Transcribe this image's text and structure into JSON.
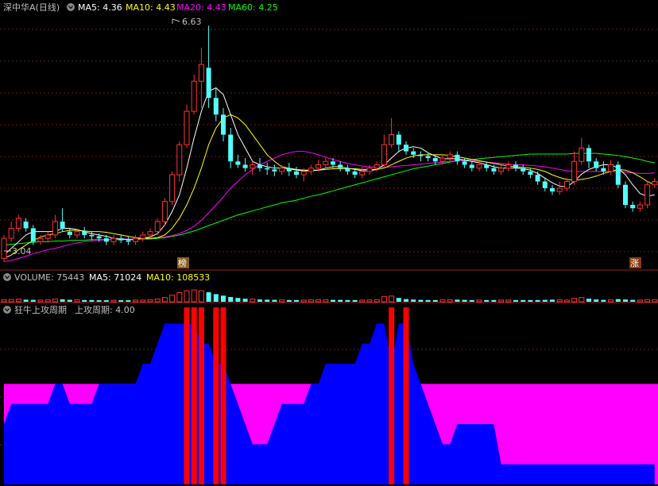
{
  "header": {
    "stock_title": "深中华A(日线)",
    "ma5_label": "MA5: 4.36",
    "ma10_label": "MA10: 4.43",
    "ma20_label": "MA20: 4.43",
    "ma60_label": "MA60: 4.25"
  },
  "annotations": {
    "high_label": "6.63",
    "low_label": "3.04",
    "marker_bang": "榜",
    "marker_zhang": "涨"
  },
  "volume_header": {
    "title": "VOLUME: 75443",
    "ma5_label": "MA5: 71024",
    "ma10_label": "MA10: 108533"
  },
  "indicator_header": {
    "title": "狂牛上攻周期",
    "value_label": "上攻周期: 4.00"
  },
  "colors": {
    "up": "#ff3232",
    "down": "#54ffff",
    "ma5": "#ffffff",
    "ma10": "#ffff00",
    "ma20": "#ff00ff",
    "ma60": "#00ff00",
    "magenta_area": "#ff00ff",
    "blue_area": "#0000ff",
    "red_bar": "#ff0000",
    "grid": "#7a1515"
  },
  "chart_data": {
    "type": "candlestick",
    "price_ylim": [
      3.0,
      6.8
    ],
    "candles": [
      {
        "o": 3.15,
        "c": 3.45,
        "h": 3.5,
        "l": 3.1
      },
      {
        "o": 3.45,
        "c": 3.6,
        "h": 3.7,
        "l": 3.4
      },
      {
        "o": 3.6,
        "c": 3.75,
        "h": 3.8,
        "l": 3.55
      },
      {
        "o": 3.7,
        "c": 3.6,
        "h": 3.75,
        "l": 3.55
      },
      {
        "o": 3.6,
        "c": 3.4,
        "h": 3.65,
        "l": 3.35
      },
      {
        "o": 3.4,
        "c": 3.45,
        "h": 3.5,
        "l": 3.35
      },
      {
        "o": 3.45,
        "c": 3.5,
        "h": 3.55,
        "l": 3.4
      },
      {
        "o": 3.5,
        "c": 3.7,
        "h": 3.8,
        "l": 3.45
      },
      {
        "o": 3.7,
        "c": 3.6,
        "h": 3.9,
        "l": 3.55
      },
      {
        "o": 3.55,
        "c": 3.5,
        "h": 3.6,
        "l": 3.45
      },
      {
        "o": 3.5,
        "c": 3.55,
        "h": 3.6,
        "l": 3.45
      },
      {
        "o": 3.55,
        "c": 3.5,
        "h": 3.62,
        "l": 3.45
      },
      {
        "o": 3.5,
        "c": 3.48,
        "h": 3.55,
        "l": 3.42
      },
      {
        "o": 3.48,
        "c": 3.45,
        "h": 3.52,
        "l": 3.4
      },
      {
        "o": 3.45,
        "c": 3.4,
        "h": 3.5,
        "l": 3.35
      },
      {
        "o": 3.4,
        "c": 3.45,
        "h": 3.5,
        "l": 3.35
      },
      {
        "o": 3.45,
        "c": 3.42,
        "h": 3.5,
        "l": 3.38
      },
      {
        "o": 3.42,
        "c": 3.4,
        "h": 3.48,
        "l": 3.35
      },
      {
        "o": 3.4,
        "c": 3.45,
        "h": 3.5,
        "l": 3.35
      },
      {
        "o": 3.45,
        "c": 3.5,
        "h": 3.55,
        "l": 3.4
      },
      {
        "o": 3.5,
        "c": 3.55,
        "h": 3.6,
        "l": 3.45
      },
      {
        "o": 3.55,
        "c": 3.7,
        "h": 3.75,
        "l": 3.5
      },
      {
        "o": 3.7,
        "c": 4.0,
        "h": 4.05,
        "l": 3.65
      },
      {
        "o": 4.0,
        "c": 4.4,
        "h": 4.45,
        "l": 3.95
      },
      {
        "o": 4.4,
        "c": 4.85,
        "h": 4.9,
        "l": 4.3
      },
      {
        "o": 4.85,
        "c": 5.35,
        "h": 5.45,
        "l": 4.8
      },
      {
        "o": 5.35,
        "c": 5.8,
        "h": 5.9,
        "l": 5.3
      },
      {
        "o": 5.8,
        "c": 6.05,
        "h": 6.3,
        "l": 5.4
      },
      {
        "o": 6.0,
        "c": 5.55,
        "h": 6.63,
        "l": 5.4
      },
      {
        "o": 5.55,
        "c": 5.3,
        "h": 5.7,
        "l": 5.2
      },
      {
        "o": 5.3,
        "c": 5.0,
        "h": 5.4,
        "l": 4.9
      },
      {
        "o": 5.0,
        "c": 4.6,
        "h": 5.1,
        "l": 4.5
      },
      {
        "o": 4.6,
        "c": 4.55,
        "h": 4.7,
        "l": 4.5
      },
      {
        "o": 4.55,
        "c": 4.5,
        "h": 4.65,
        "l": 4.45
      },
      {
        "o": 4.5,
        "c": 4.55,
        "h": 4.6,
        "l": 4.4
      },
      {
        "o": 4.55,
        "c": 4.5,
        "h": 4.65,
        "l": 4.45
      },
      {
        "o": 4.5,
        "c": 4.48,
        "h": 4.58,
        "l": 4.4
      },
      {
        "o": 4.48,
        "c": 4.45,
        "h": 4.55,
        "l": 4.38
      },
      {
        "o": 4.45,
        "c": 4.5,
        "h": 4.55,
        "l": 4.4
      },
      {
        "o": 4.5,
        "c": 4.45,
        "h": 4.58,
        "l": 4.38
      },
      {
        "o": 4.45,
        "c": 4.4,
        "h": 4.52,
        "l": 4.35
      },
      {
        "o": 4.4,
        "c": 4.45,
        "h": 4.5,
        "l": 4.3
      },
      {
        "o": 4.45,
        "c": 4.5,
        "h": 4.55,
        "l": 4.4
      },
      {
        "o": 4.5,
        "c": 4.55,
        "h": 4.62,
        "l": 4.45
      },
      {
        "o": 4.55,
        "c": 4.6,
        "h": 4.65,
        "l": 4.5
      },
      {
        "o": 4.6,
        "c": 4.55,
        "h": 4.65,
        "l": 4.5
      },
      {
        "o": 4.55,
        "c": 4.5,
        "h": 4.6,
        "l": 4.45
      },
      {
        "o": 4.5,
        "c": 4.45,
        "h": 4.55,
        "l": 4.4
      },
      {
        "o": 4.45,
        "c": 4.4,
        "h": 4.5,
        "l": 4.35
      },
      {
        "o": 4.4,
        "c": 4.45,
        "h": 4.52,
        "l": 4.35
      },
      {
        "o": 4.45,
        "c": 4.5,
        "h": 4.55,
        "l": 4.4
      },
      {
        "o": 4.5,
        "c": 4.55,
        "h": 4.6,
        "l": 4.45
      },
      {
        "o": 4.55,
        "c": 4.85,
        "h": 5.0,
        "l": 4.5
      },
      {
        "o": 4.85,
        "c": 5.0,
        "h": 5.25,
        "l": 4.8
      },
      {
        "o": 5.0,
        "c": 4.85,
        "h": 5.05,
        "l": 4.75
      },
      {
        "o": 4.85,
        "c": 4.75,
        "h": 4.9,
        "l": 4.7
      },
      {
        "o": 4.75,
        "c": 4.7,
        "h": 4.8,
        "l": 4.65
      },
      {
        "o": 4.7,
        "c": 4.68,
        "h": 4.75,
        "l": 4.6
      },
      {
        "o": 4.68,
        "c": 4.65,
        "h": 4.72,
        "l": 4.6
      },
      {
        "o": 4.65,
        "c": 4.6,
        "h": 4.7,
        "l": 4.55
      },
      {
        "o": 4.6,
        "c": 4.65,
        "h": 4.7,
        "l": 4.55
      },
      {
        "o": 4.65,
        "c": 4.7,
        "h": 4.75,
        "l": 4.6
      },
      {
        "o": 4.7,
        "c": 4.6,
        "h": 4.75,
        "l": 4.55
      },
      {
        "o": 4.6,
        "c": 4.55,
        "h": 4.65,
        "l": 4.5
      },
      {
        "o": 4.55,
        "c": 4.5,
        "h": 4.6,
        "l": 4.45
      },
      {
        "o": 4.5,
        "c": 4.55,
        "h": 4.6,
        "l": 4.45
      },
      {
        "o": 4.55,
        "c": 4.5,
        "h": 4.6,
        "l": 4.45
      },
      {
        "o": 4.5,
        "c": 4.45,
        "h": 4.55,
        "l": 4.4
      },
      {
        "o": 4.45,
        "c": 4.5,
        "h": 4.55,
        "l": 4.4
      },
      {
        "o": 4.5,
        "c": 4.55,
        "h": 4.6,
        "l": 4.45
      },
      {
        "o": 4.55,
        "c": 4.5,
        "h": 4.6,
        "l": 4.45
      },
      {
        "o": 4.5,
        "c": 4.45,
        "h": 4.55,
        "l": 4.4
      },
      {
        "o": 4.45,
        "c": 4.4,
        "h": 4.5,
        "l": 4.35
      },
      {
        "o": 4.4,
        "c": 4.3,
        "h": 4.45,
        "l": 4.25
      },
      {
        "o": 4.3,
        "c": 4.2,
        "h": 4.35,
        "l": 4.15
      },
      {
        "o": 4.2,
        "c": 4.15,
        "h": 4.25,
        "l": 4.1
      },
      {
        "o": 4.15,
        "c": 4.2,
        "h": 4.3,
        "l": 4.1
      },
      {
        "o": 4.2,
        "c": 4.3,
        "h": 4.35,
        "l": 4.15
      },
      {
        "o": 4.3,
        "c": 4.6,
        "h": 4.75,
        "l": 4.25
      },
      {
        "o": 4.6,
        "c": 4.8,
        "h": 4.95,
        "l": 4.55
      },
      {
        "o": 4.8,
        "c": 4.6,
        "h": 4.85,
        "l": 4.5
      },
      {
        "o": 4.6,
        "c": 4.5,
        "h": 4.65,
        "l": 4.45
      },
      {
        "o": 4.5,
        "c": 4.45,
        "h": 4.6,
        "l": 4.4
      },
      {
        "o": 4.45,
        "c": 4.55,
        "h": 4.62,
        "l": 4.4
      },
      {
        "o": 4.55,
        "c": 4.25,
        "h": 4.6,
        "l": 4.2
      },
      {
        "o": 4.25,
        "c": 3.95,
        "h": 4.3,
        "l": 3.9
      },
      {
        "o": 3.95,
        "c": 3.9,
        "h": 4.0,
        "l": 3.85
      },
      {
        "o": 3.9,
        "c": 3.95,
        "h": 4.0,
        "l": 3.85
      },
      {
        "o": 3.95,
        "c": 4.25,
        "h": 4.3,
        "l": 3.9
      },
      {
        "o": 4.25,
        "c": 4.3,
        "h": 4.35,
        "l": 4.2
      }
    ],
    "ma5": [
      3.2,
      3.3,
      3.4,
      3.5,
      3.55,
      3.55,
      3.55,
      3.55,
      3.6,
      3.6,
      3.58,
      3.55,
      3.52,
      3.5,
      3.48,
      3.45,
      3.44,
      3.43,
      3.43,
      3.45,
      3.47,
      3.52,
      3.65,
      3.85,
      4.1,
      4.5,
      4.95,
      5.35,
      5.65,
      5.7,
      5.6,
      5.3,
      5.0,
      4.8,
      4.6,
      4.55,
      4.52,
      4.5,
      4.5,
      4.49,
      4.47,
      4.46,
      4.46,
      4.47,
      4.5,
      4.52,
      4.52,
      4.5,
      4.48,
      4.46,
      4.46,
      4.48,
      4.55,
      4.65,
      4.75,
      4.8,
      4.82,
      4.8,
      4.73,
      4.68,
      4.64,
      4.64,
      4.64,
      4.62,
      4.6,
      4.58,
      4.55,
      4.52,
      4.5,
      4.5,
      4.5,
      4.49,
      4.47,
      4.42,
      4.35,
      4.28,
      4.23,
      4.22,
      4.3,
      4.41,
      4.48,
      4.52,
      4.55,
      4.55,
      4.5,
      4.4,
      4.25,
      4.12,
      4.08,
      4.1
    ],
    "ma10": [
      3.15,
      3.2,
      3.28,
      3.35,
      3.42,
      3.47,
      3.5,
      3.52,
      3.55,
      3.57,
      3.57,
      3.56,
      3.55,
      3.55,
      3.54,
      3.52,
      3.5,
      3.48,
      3.46,
      3.45,
      3.45,
      3.46,
      3.5,
      3.6,
      3.75,
      3.95,
      4.2,
      4.5,
      4.85,
      5.1,
      5.25,
      5.3,
      5.25,
      5.15,
      5.0,
      4.85,
      4.7,
      4.6,
      4.52,
      4.5,
      4.48,
      4.47,
      4.47,
      4.47,
      4.48,
      4.49,
      4.49,
      4.49,
      4.49,
      4.48,
      4.48,
      4.48,
      4.5,
      4.55,
      4.6,
      4.65,
      4.68,
      4.7,
      4.7,
      4.7,
      4.7,
      4.69,
      4.67,
      4.65,
      4.63,
      4.61,
      4.59,
      4.57,
      4.55,
      4.53,
      4.52,
      4.51,
      4.5,
      4.48,
      4.45,
      4.4,
      4.36,
      4.33,
      4.32,
      4.33,
      4.35,
      4.38,
      4.42,
      4.45,
      4.48,
      4.47,
      4.43,
      4.37,
      4.3,
      4.25
    ],
    "ma20": [
      3.1,
      3.12,
      3.15,
      3.18,
      3.22,
      3.25,
      3.28,
      3.3,
      3.33,
      3.36,
      3.38,
      3.4,
      3.41,
      3.42,
      3.43,
      3.44,
      3.44,
      3.44,
      3.44,
      3.45,
      3.45,
      3.46,
      3.47,
      3.49,
      3.52,
      3.57,
      3.63,
      3.72,
      3.83,
      3.95,
      4.07,
      4.2,
      4.3,
      4.4,
      4.48,
      4.55,
      4.6,
      4.65,
      4.7,
      4.73,
      4.75,
      4.75,
      4.73,
      4.7,
      4.66,
      4.63,
      4.6,
      4.57,
      4.55,
      4.53,
      4.52,
      4.51,
      4.51,
      4.52,
      4.53,
      4.54,
      4.55,
      4.56,
      4.57,
      4.58,
      4.59,
      4.6,
      4.61,
      4.61,
      4.61,
      4.6,
      4.59,
      4.58,
      4.57,
      4.56,
      4.55,
      4.55,
      4.54,
      4.53,
      4.52,
      4.5,
      4.48,
      4.46,
      4.45,
      4.45,
      4.45,
      4.45,
      4.45,
      4.45,
      4.45,
      4.44,
      4.43,
      4.42,
      4.42,
      4.43
    ],
    "ma60": [
      3.35,
      3.36,
      3.37,
      3.38,
      3.39,
      3.4,
      3.4,
      3.41,
      3.41,
      3.42,
      3.42,
      3.42,
      3.43,
      3.43,
      3.43,
      3.43,
      3.43,
      3.44,
      3.44,
      3.44,
      3.44,
      3.45,
      3.46,
      3.48,
      3.5,
      3.53,
      3.56,
      3.6,
      3.64,
      3.68,
      3.72,
      3.76,
      3.8,
      3.83,
      3.86,
      3.89,
      3.92,
      3.95,
      3.98,
      4.0,
      4.02,
      4.05,
      4.08,
      4.1,
      4.13,
      4.16,
      4.19,
      4.22,
      4.25,
      4.28,
      4.31,
      4.34,
      4.37,
      4.4,
      4.43,
      4.46,
      4.49,
      4.51,
      4.53,
      4.55,
      4.57,
      4.59,
      4.61,
      4.62,
      4.63,
      4.64,
      4.65,
      4.66,
      4.67,
      4.68,
      4.69,
      4.7,
      4.71,
      4.71,
      4.71,
      4.71,
      4.71,
      4.71,
      4.72,
      4.72,
      4.72,
      4.72,
      4.71,
      4.7,
      4.69,
      4.67,
      4.65,
      4.63,
      4.6,
      4.58
    ],
    "volume": [
      10,
      12,
      14,
      11,
      10,
      9,
      10,
      14,
      13,
      10,
      10,
      9,
      9,
      8,
      8,
      8,
      8,
      8,
      9,
      9,
      10,
      14,
      22,
      35,
      48,
      58,
      62,
      58,
      50,
      40,
      32,
      25,
      20,
      16,
      14,
      12,
      11,
      10,
      10,
      9,
      9,
      9,
      10,
      10,
      11,
      10,
      10,
      9,
      9,
      9,
      10,
      11,
      28,
      30,
      20,
      14,
      12,
      10,
      9,
      9,
      10,
      10,
      11,
      10,
      9,
      9,
      9,
      9,
      9,
      9,
      9,
      9,
      9,
      9,
      10,
      11,
      10,
      9,
      18,
      22,
      16,
      12,
      10,
      10,
      14,
      12,
      10,
      9,
      12,
      11
    ],
    "volume_ylim": [
      0,
      100
    ],
    "indicator": {
      "levels": [
        3,
        4,
        4,
        4,
        4,
        4,
        4,
        5,
        5,
        4,
        4,
        4,
        4,
        5,
        5,
        5,
        5,
        5,
        5,
        6,
        6,
        7,
        8,
        8,
        8,
        8,
        8,
        7,
        7,
        6,
        6,
        5,
        4,
        3,
        2,
        2,
        2,
        3,
        4,
        4,
        4,
        4,
        5,
        5,
        6,
        6,
        6,
        6,
        6,
        7,
        7,
        8,
        8,
        6,
        8,
        8,
        6,
        5,
        4,
        3,
        2,
        2,
        3,
        3,
        3,
        3,
        3,
        3,
        1,
        1,
        1,
        1,
        1,
        1,
        1,
        1,
        1,
        1,
        1,
        1,
        1,
        1,
        1,
        1,
        1,
        1,
        1,
        1,
        1,
        1
      ],
      "magenta_level": 5,
      "red_bar_indices": [
        25,
        26,
        27,
        29,
        30,
        53,
        55
      ],
      "ylim": [
        0,
        9
      ]
    }
  }
}
